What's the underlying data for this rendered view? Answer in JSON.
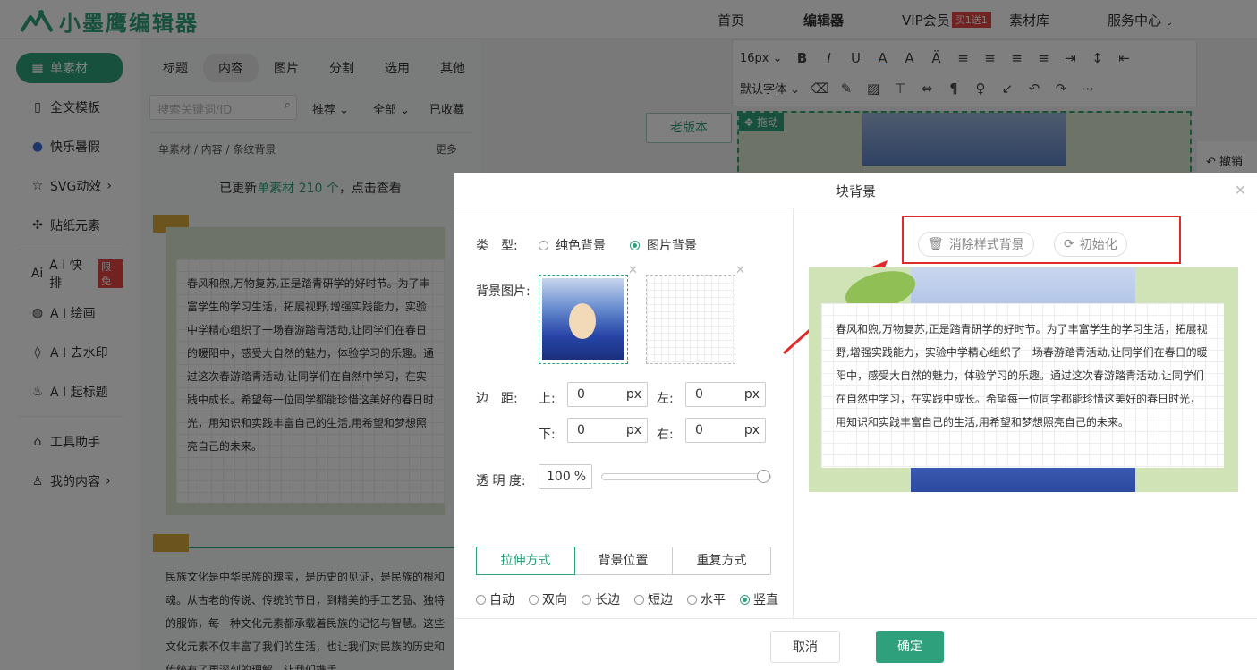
{
  "app": {
    "logo_text": "小墨鹰编辑器",
    "brand_color": "#2ea07b"
  },
  "topnav": {
    "home": "首页",
    "editor": "编辑器",
    "vip": "VIP会员",
    "vip_badge": "买1送1",
    "materials": "素材库",
    "service": "服务中心"
  },
  "sidebar": {
    "items": [
      {
        "label": "单素材",
        "icon": "grid-icon"
      },
      {
        "label": "全文模板",
        "icon": "template-icon"
      },
      {
        "label": "快乐暑假",
        "icon": "ball-icon"
      },
      {
        "label": "SVG动效",
        "icon": "star-icon"
      },
      {
        "label": "贴纸元素",
        "icon": "puzzle-icon"
      },
      {
        "label": "A I 快排",
        "icon": "ai-icon",
        "badge": "限免"
      },
      {
        "label": "A I 绘画",
        "icon": "palette-icon"
      },
      {
        "label": "A I 去水印",
        "icon": "drop-icon"
      },
      {
        "label": "A I 起标题",
        "icon": "fire-icon"
      },
      {
        "label": "工具助手",
        "icon": "tools-icon"
      },
      {
        "label": "我的内容",
        "icon": "user-icon"
      }
    ]
  },
  "materials_panel": {
    "tabs": [
      "标题",
      "内容",
      "图片",
      "分割",
      "选用",
      "其他"
    ],
    "search_placeholder": "搜索关键词/ID",
    "filter_recommend": "推荐",
    "filter_all": "全部",
    "filter_saved": "已收藏",
    "breadcrumb": "单素材 / 内容 / 条纹背景",
    "more": "更多",
    "update_prefix": "已更新",
    "update_highlight": "单素材 210 个",
    "update_suffix": "，点击查看",
    "card1_text": "春风和煦,万物复苏,正是踏青研学的好时节。为了丰富学生的学习生活，拓展视野,增强实践能力，实验中学精心组织了一场春游踏青活动,让同学们在春日的暖阳中，感受大自然的魅力，体验学习的乐趣。通过这次春游踏青活动,让同学们在自然中学习，在实践中成长。希望每一位同学都能珍惜这美好的春日时光，用知识和实践丰富自己的生活,用希望和梦想照亮自己的未来。",
    "card2_text": "民族文化是中华民族的瑰宝，是历史的见证，是民族的根和魂。从古老的传说、传统的节日，到精美的手工艺品、独特的服饰，每一种文化元素都承载着民族的记忆与智慧。这些文化元素不仅丰富了我们的生活，也让我们对民族的历史和传统有了更深刻的理解，让我们携手"
  },
  "editor": {
    "old_version": "老版本",
    "drag_label": "拖动",
    "font_size": "16px",
    "font_family": "默认字体",
    "undo": "撤销"
  },
  "modal": {
    "title": "块背景",
    "type_label": "类　型:",
    "type_solid": "纯色背景",
    "type_image": "图片背景",
    "bg_image_label": "背景图片:",
    "margin_label": "边　距:",
    "top_label": "上:",
    "left_label": "左:",
    "bottom_label": "下:",
    "right_label": "右:",
    "margin_top": "0",
    "margin_left": "0",
    "margin_bottom": "0",
    "margin_right": "0",
    "unit_px": "px",
    "opacity_label": "透 明 度:",
    "opacity_value": "100",
    "opacity_unit": "%",
    "opacity_level": 1.0,
    "seg_tabs": [
      "拉伸方式",
      "背景位置",
      "重复方式"
    ],
    "stretch_options": [
      "自动",
      "双向",
      "长边",
      "短边",
      "水平",
      "竖直"
    ],
    "stretch_selected": "竖直",
    "clear_bg": "消除样式背景",
    "reset": "初始化",
    "preview_text": "春风和煦,万物复苏,正是踏青研学的好时节。为了丰富学生的学习生活，拓展视野,增强实践能力，实验中学精心组织了一场春游踏青活动,让同学们在春日的暖阳中，感受大自然的魅力，体验学习的乐趣。通过这次春游踏青活动,让同学们在自然中学习，在实践中成长。希望每一位同学都能珍惜这美好的春日时光，用知识和实践丰富自己的生活,用希望和梦想照亮自己的未来。",
    "cancel": "取消",
    "confirm": "确定"
  }
}
